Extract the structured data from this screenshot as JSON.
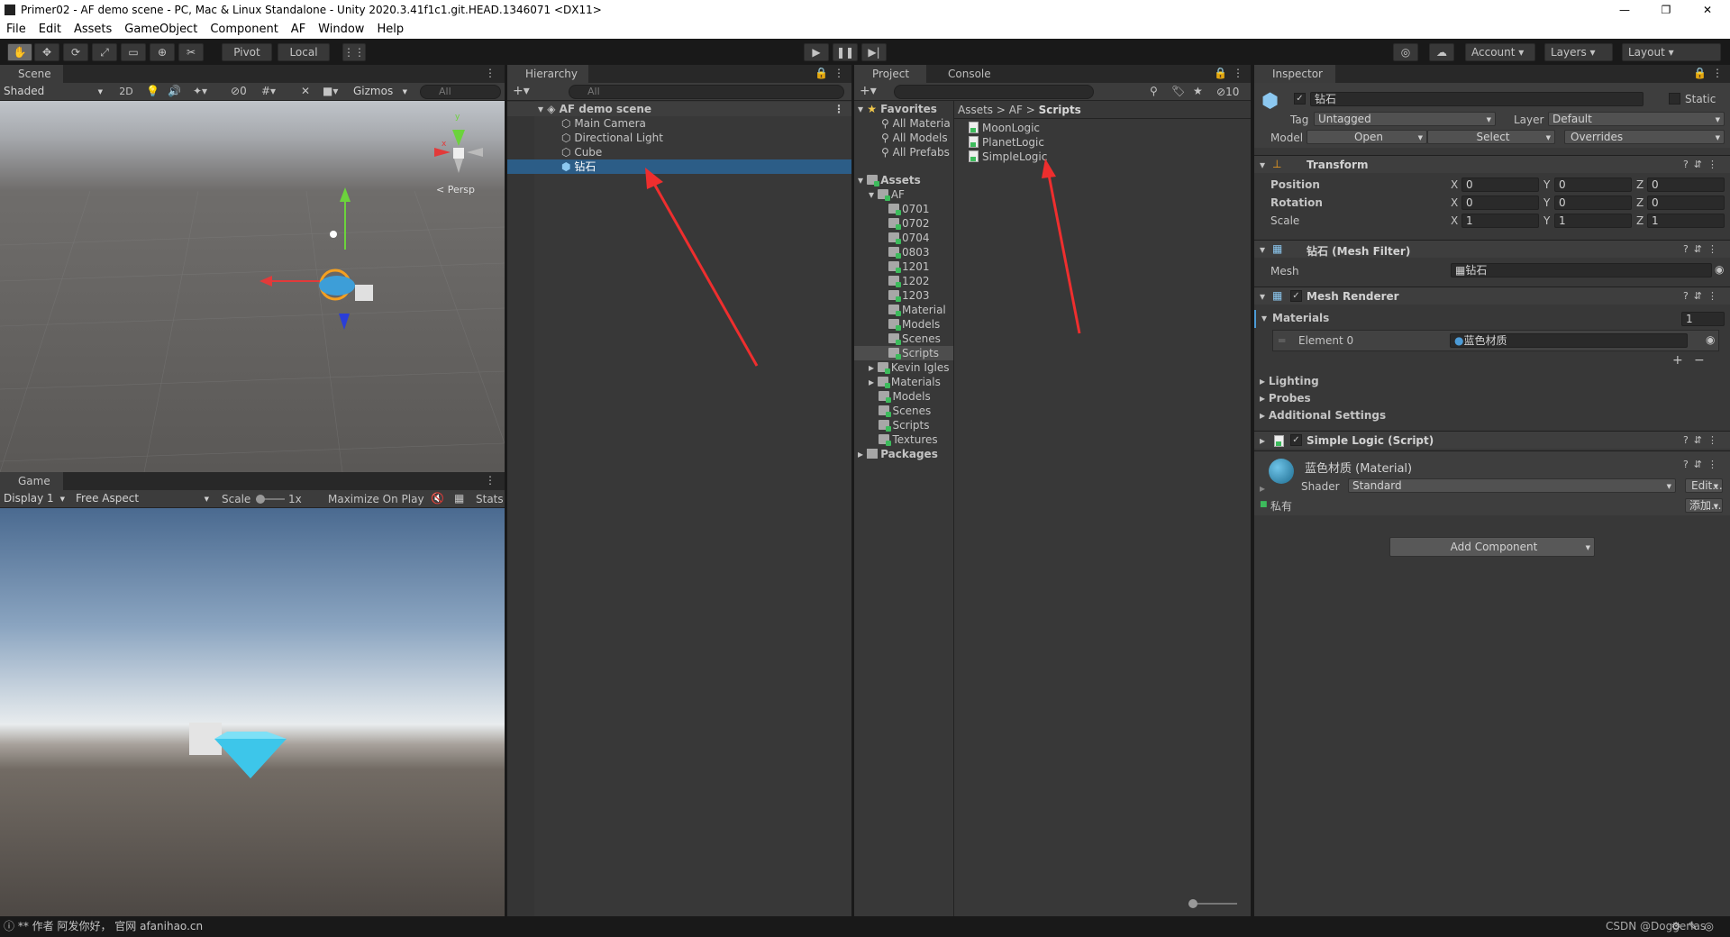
{
  "window": {
    "title": "Primer02 - AF demo scene - PC, Mac & Linux Standalone - Unity 2020.3.41f1c1.git.HEAD.1346071 <DX11>"
  },
  "menu": [
    "File",
    "Edit",
    "Assets",
    "GameObject",
    "Component",
    "AF",
    "Window",
    "Help"
  ],
  "toolbar": {
    "pivot": "Pivot",
    "local": "Local",
    "account": "Account",
    "layers": "Layers",
    "layout": "Layout"
  },
  "scene": {
    "tab": "Scene",
    "shading": "Shaded",
    "mode2d": "2D",
    "hidden_count": "0",
    "gizmos": "Gizmos",
    "search_placeholder": "All",
    "persp": "< Persp",
    "gizmo_axes": {
      "y": "y",
      "x": "x"
    }
  },
  "game": {
    "tab": "Game",
    "display": "Display 1",
    "aspect": "Free Aspect",
    "scale_label": "Scale",
    "scale_value": "1x",
    "maximize": "Maximize On Play",
    "stats": "Stats"
  },
  "hierarchy": {
    "tab": "Hierarchy",
    "search_placeholder": "All",
    "scene_name": "AF demo scene",
    "items": [
      "Main Camera",
      "Directional Light",
      "Cube",
      "钻石"
    ]
  },
  "project": {
    "tab": "Project",
    "console_tab": "Console",
    "hidden_count": "10",
    "favorites": {
      "label": "Favorites",
      "items": [
        "All Materia",
        "All Models",
        "All Prefabs"
      ]
    },
    "assets_label": "Assets",
    "af_label": "AF",
    "af_children": [
      "0701",
      "0702",
      "0704",
      "0803",
      "1201",
      "1202",
      "1203",
      "Material",
      "Models",
      "Scenes",
      "Scripts"
    ],
    "asset_folders": [
      "Kevin Igles",
      "Materials",
      "Models",
      "Scenes",
      "Scripts",
      "Textures"
    ],
    "packages": "Packages",
    "breadcrumb": [
      "Assets",
      "AF",
      "Scripts"
    ],
    "files": [
      "MoonLogic",
      "PlanetLogic",
      "SimpleLogic"
    ]
  },
  "inspector": {
    "tab": "Inspector",
    "object_name": "钻石",
    "static": "Static",
    "tag_label": "Tag",
    "tag": "Untagged",
    "layer_label": "Layer",
    "layer": "Default",
    "model_label": "Model",
    "open": "Open",
    "select": "Select",
    "overrides": "Overrides",
    "transform": {
      "title": "Transform",
      "position": "Position",
      "rotation": "Rotation",
      "scale": "Scale",
      "x": "X",
      "y": "Y",
      "z": "Z",
      "pos": [
        "0",
        "0",
        "0"
      ],
      "rot": [
        "0",
        "0",
        "0"
      ],
      "scl": [
        "1",
        "1",
        "1"
      ]
    },
    "mesh_filter": {
      "title": "钻石 (Mesh Filter)",
      "mesh_label": "Mesh",
      "mesh": "钻石"
    },
    "mesh_renderer": {
      "title": "Mesh Renderer",
      "materials": "Materials",
      "count": "1",
      "element": "Element 0",
      "material": "蓝色材质",
      "lighting": "Lighting",
      "probes": "Probes",
      "additional": "Additional Settings"
    },
    "script": {
      "title": "Simple Logic (Script)"
    },
    "material": {
      "name": "蓝色材质 (Material)",
      "shader_label": "Shader",
      "shader": "Standard",
      "edit": "Edit...",
      "private": "私有",
      "add": "添加..."
    },
    "add_component": "Add Component"
  },
  "statusbar": {
    "text": "** 作者 阿发你好， 官网 afanihao.cn",
    "watermark": "CSDN @Doggerlas"
  },
  "colors": {
    "selection": "#2c5d87",
    "accent_blue": "#4c9bd6",
    "annotation_arrow": "#ee2e2e",
    "diamond": "#3dc6ea"
  }
}
